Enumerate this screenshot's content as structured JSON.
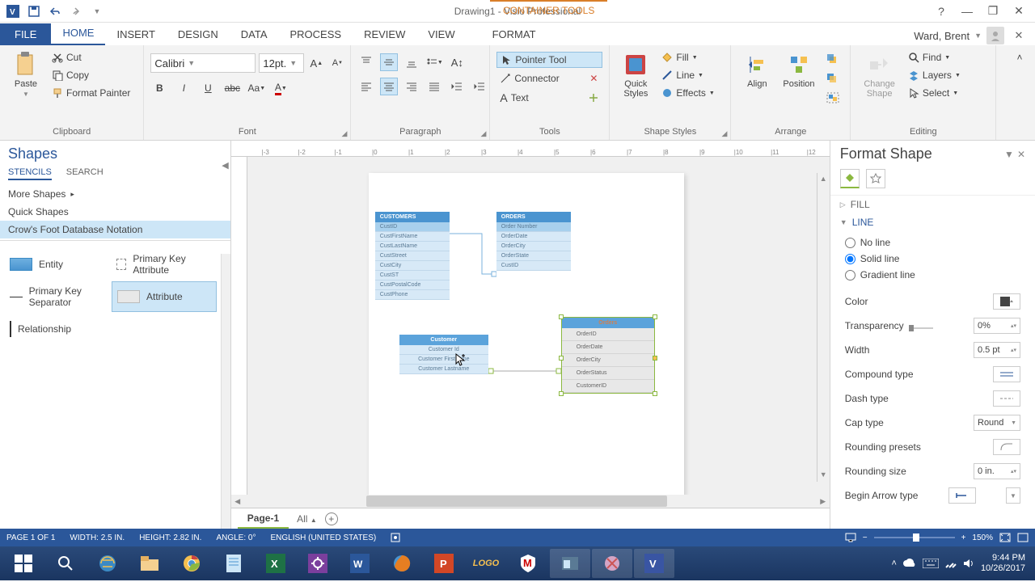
{
  "titlebar": {
    "document": "Drawing1 - Visio Professional",
    "tool_tab": "CONTAINER TOOLS"
  },
  "user": {
    "name": "Ward, Brent"
  },
  "ribbon_tabs": [
    "FILE",
    "HOME",
    "INSERT",
    "DESIGN",
    "DATA",
    "PROCESS",
    "REVIEW",
    "VIEW",
    "FORMAT"
  ],
  "ribbon": {
    "clipboard": {
      "paste": "Paste",
      "cut": "Cut",
      "copy": "Copy",
      "format_painter": "Format Painter",
      "label": "Clipboard"
    },
    "font": {
      "name": "Calibri",
      "size": "12pt.",
      "label": "Font"
    },
    "paragraph": {
      "label": "Paragraph"
    },
    "tools": {
      "pointer": "Pointer Tool",
      "connector": "Connector",
      "text": "Text",
      "label": "Tools"
    },
    "shape_styles": {
      "quick": "Quick\nStyles",
      "fill": "Fill",
      "line": "Line",
      "effects": "Effects",
      "label": "Shape Styles"
    },
    "arrange": {
      "align": "Align",
      "position": "Position",
      "label": "Arrange"
    },
    "editing": {
      "change": "Change\nShape",
      "find": "Find",
      "layers": "Layers",
      "select": "Select",
      "label": "Editing"
    }
  },
  "shapes": {
    "title": "Shapes",
    "tabs": [
      "STENCILS",
      "SEARCH"
    ],
    "more": "More Shapes",
    "quick": "Quick Shapes",
    "active_stencil": "Crow's Foot Database Notation",
    "items": [
      {
        "name": "Entity"
      },
      {
        "name": "Primary Key Attribute"
      },
      {
        "name": "Primary Key Separator"
      },
      {
        "name": "Attribute"
      },
      {
        "name": "Relationship"
      }
    ]
  },
  "canvas": {
    "tables": {
      "customers": {
        "title": "CUSTOMERS",
        "rows": [
          "CustID",
          "CustFirstName",
          "CustLastName",
          "CustStreet",
          "CustCity",
          "CustST",
          "CustPostalCode",
          "CustPhone"
        ]
      },
      "orders_top": {
        "title": "ORDERS",
        "rows": [
          "Order Number",
          "OrderDate",
          "OrderCity",
          "OrderState",
          "CustID"
        ]
      },
      "customer": {
        "title": "Customer",
        "rows": [
          "Customer Id",
          "Customer Firstname",
          "Customer Lastname"
        ]
      },
      "orders_sel": {
        "title": "Orders",
        "rows": [
          "OrderID",
          "OrderDate",
          "OrderCity",
          "OrderStatus",
          "CustomerID"
        ]
      }
    },
    "page_tab": "Page-1",
    "all": "All"
  },
  "format_pane": {
    "title": "Format Shape",
    "fill": "FILL",
    "line": "LINE",
    "options": {
      "none": "No line",
      "solid": "Solid line",
      "gradient": "Gradient line"
    },
    "props": {
      "color": "Color",
      "transparency": "Transparency",
      "transparency_val": "0%",
      "width": "Width",
      "width_val": "0.5 pt",
      "compound": "Compound type",
      "dash": "Dash type",
      "cap": "Cap type",
      "cap_val": "Round",
      "rounding_presets": "Rounding presets",
      "rounding_size": "Rounding size",
      "rounding_size_val": "0 in.",
      "begin_arrow": "Begin Arrow type"
    }
  },
  "statusbar": {
    "page": "PAGE 1 OF 1",
    "width": "WIDTH: 2.5 IN.",
    "height": "HEIGHT: 2.82 IN.",
    "angle": "ANGLE: 0°",
    "lang": "ENGLISH (UNITED STATES)",
    "zoom": "150%"
  },
  "taskbar": {
    "time": "9:44 PM",
    "date": "10/26/2017"
  }
}
